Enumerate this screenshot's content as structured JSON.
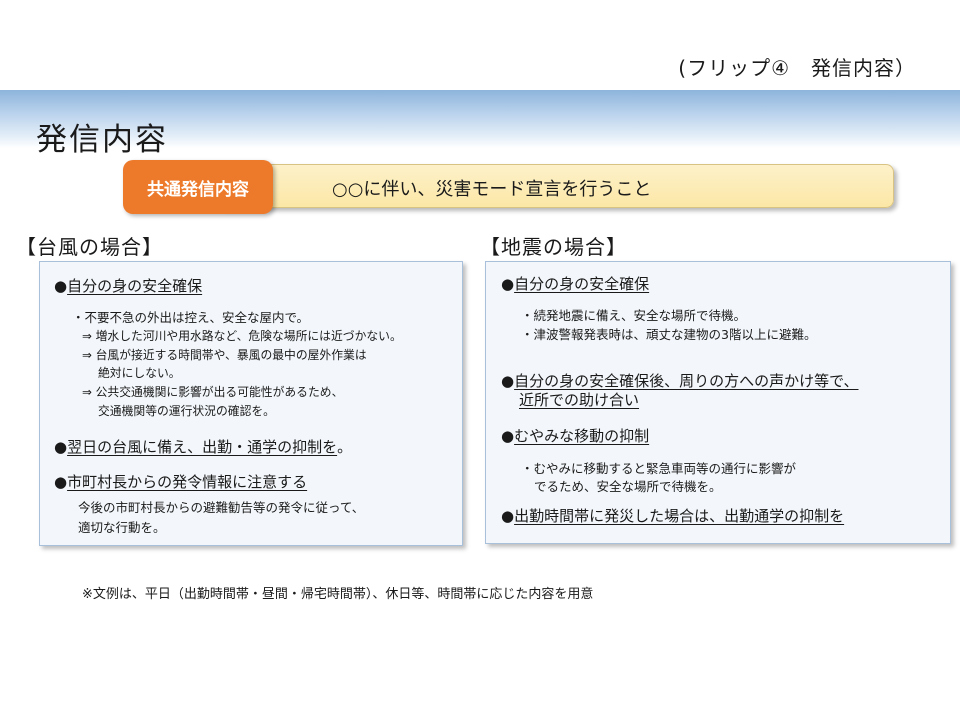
{
  "flip_note": "(フリップ④　発信内容）",
  "title": "発信内容",
  "common": {
    "label": "共通発信内容",
    "message": "○○に伴い、災害モード宣言を行うこと"
  },
  "typhoon": {
    "heading": "【台風の場合】",
    "items": [
      {
        "mark": "●",
        "heading": "自分の身の安全確保"
      },
      {
        "mark": "●",
        "heading": "翌日の台風に備え、出勤・通学の抑制を",
        "tail": "。"
      },
      {
        "mark": "●",
        "heading": "市町村長からの発令情報に注意する"
      }
    ],
    "lines": [
      "・不要不急の外出は控え、安全な屋内で。",
      "⇒ 増水した河川や用水路など、危険な場所には近づかない。",
      "⇒ 台風が接近する時間帯や、暴風の最中の屋外作業は",
      "絶対にしない。",
      "⇒ 公共交通機関に影響が出る可能性があるため、",
      "交通機関等の運行状況の確認を。",
      "今後の市町村長からの避難勧告等の発令に従って、",
      "適切な行動を。"
    ]
  },
  "earthquake": {
    "heading": "【地震の場合】",
    "items": [
      {
        "mark": "●",
        "heading": "自分の身の安全確保"
      },
      {
        "mark": "●",
        "heading": "自分の身の安全確保後、周りの方への声かけ等で、",
        "heading_2": "近所での助け合い"
      },
      {
        "mark": "●",
        "heading": "むやみな移動の抑制"
      },
      {
        "mark": "●",
        "heading": "出勤時間帯に発災した場合は、出勤通学の抑制を"
      }
    ],
    "lines": [
      "・続発地震に備え、安全な場所で待機。",
      "・津波警報発表時は、頑丈な建物の3階以上に避難。",
      "・むやみに移動すると緊急車両等の通行に影響が",
      "でるため、安全な場所で待機を",
      "。"
    ]
  },
  "footnote": "※文例は、平日（出勤時間帯・昼間・帰宅時間帯）、休日等、時間帯に応じた内容を用意"
}
